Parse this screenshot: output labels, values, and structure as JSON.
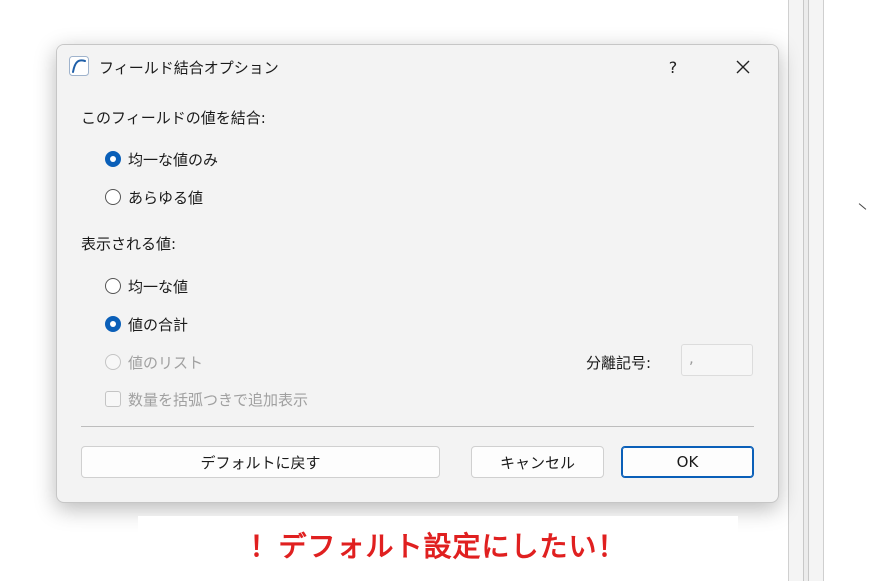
{
  "dialog": {
    "title": "フィールド結合オプション",
    "help_label": "?",
    "combine_section": {
      "heading": "このフィールドの値を結合:",
      "options": [
        {
          "label": "均一な値のみ",
          "checked": true
        },
        {
          "label": "あらゆる値",
          "checked": false
        }
      ]
    },
    "display_section": {
      "heading": "表示される値:",
      "options": [
        {
          "label": "均一な値",
          "checked": false
        },
        {
          "label": "値の合計",
          "checked": true
        },
        {
          "label": "値のリスト",
          "checked": false,
          "disabled": true
        }
      ],
      "separator_label": "分離記号:",
      "separator_value": ",",
      "show_count_label": "数量を括弧つきで追加表示"
    },
    "buttons": {
      "reset": "デフォルトに戻す",
      "cancel": "キャンセル",
      "ok": "OK"
    }
  },
  "banner": {
    "text": "！デフォルト設定にしたい！"
  },
  "colors": {
    "accent": "#0a5fb8",
    "banner_text": "#e02020",
    "dialog_bg": "#f3f3f3",
    "disabled_text": "#a0a0a0"
  }
}
